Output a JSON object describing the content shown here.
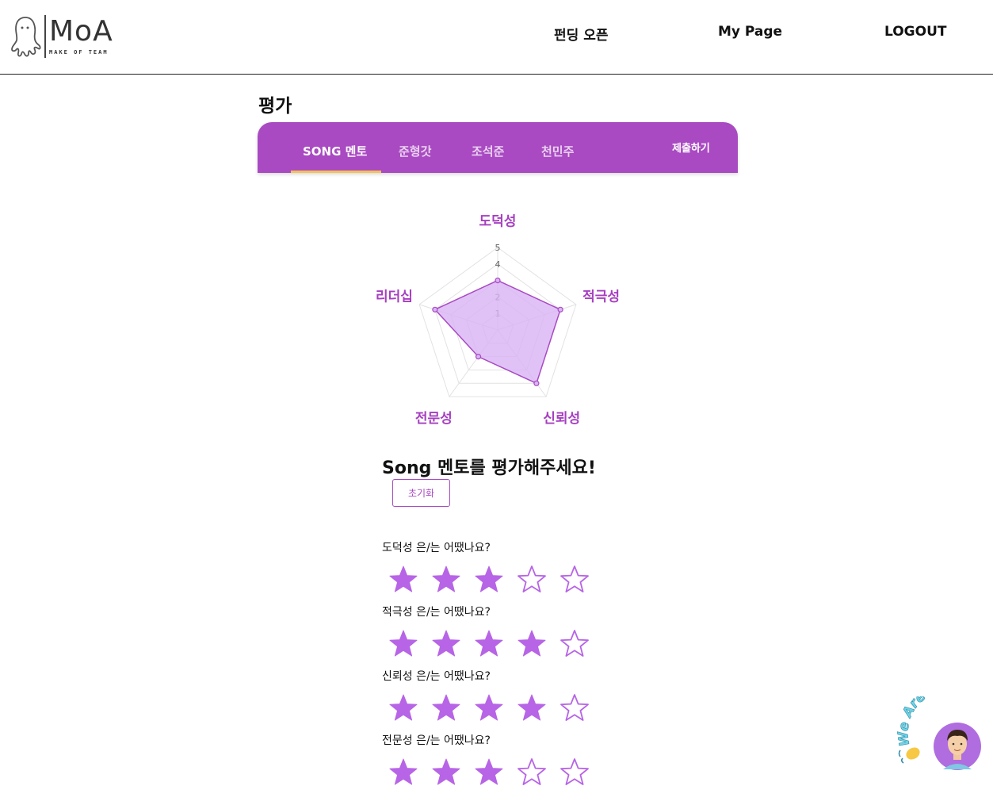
{
  "header": {
    "logo_word": "MoA",
    "logo_sub": "MAKE OF TEAM",
    "nav": {
      "funding": "펀딩 오픈",
      "mypage": "My Page",
      "logout": "LOGOUT"
    }
  },
  "page": {
    "title": "평가"
  },
  "tabs": {
    "items": [
      {
        "label": "SONG 멘토"
      },
      {
        "label": "준형갓"
      },
      {
        "label": "조석준"
      },
      {
        "label": "천민주"
      }
    ],
    "submit_label": "제출하기"
  },
  "chart_data": {
    "type": "radar",
    "axes": [
      "도덕성",
      "적극성",
      "신뢰성",
      "전문성",
      "리더십"
    ],
    "scale_ticks": [
      "1",
      "2",
      "4",
      "5"
    ],
    "range": [
      0,
      5
    ],
    "series": [
      {
        "values": [
          3,
          4,
          4,
          2,
          4
        ]
      }
    ],
    "colors": {
      "fill": "#d9b3f5",
      "stroke": "#a94ac2",
      "grid": "#e2e2e2"
    }
  },
  "evaluation": {
    "heading": "Song 멘토를 평가해주세요!",
    "reset_label": "초기화",
    "questions": [
      {
        "label": "도덕성 은/는 어땠나요?",
        "rating": 3,
        "max": 5
      },
      {
        "label": "적극성 은/는 어땠나요?",
        "rating": 4,
        "max": 5
      },
      {
        "label": "신뢰성 은/는 어땠나요?",
        "rating": 4,
        "max": 5
      },
      {
        "label": "전문성 은/는 어땠나요?",
        "rating": 3,
        "max": 5
      }
    ]
  },
  "badge": {
    "text": "We Are Here!"
  },
  "colors": {
    "accent": "#a94ac2",
    "star": "#b764e6",
    "underline": "#f4c25a"
  },
  "icons": {
    "logo": "ghost-icon",
    "star_full": "star-filled-icon",
    "star_empty": "star-outline-icon",
    "wave": "waving-hand-icon",
    "avatar": "avatar-icon"
  }
}
